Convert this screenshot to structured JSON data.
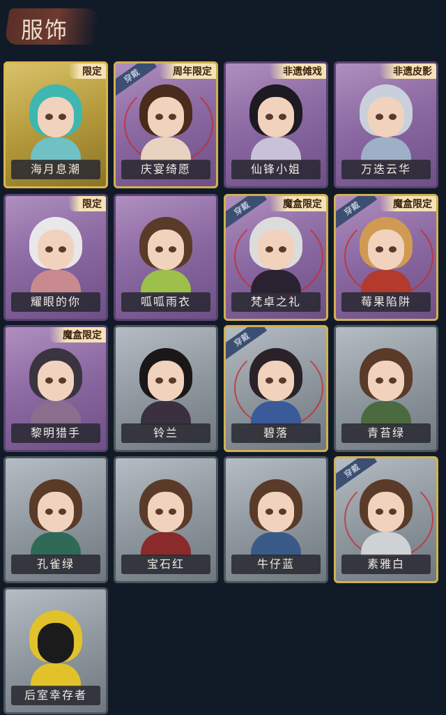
{
  "title": "服饰",
  "cards": [
    {
      "name": "海月息潮",
      "tag": "限定",
      "wearing": "",
      "frame": "gold",
      "hair": "#3fb7b0",
      "body": "#6fc1c4",
      "ring": false
    },
    {
      "name": "庆宴绮愿",
      "tag": "周年限定",
      "wearing": "穿戴",
      "frame": "purple-gold",
      "hair": "#4a2b1c",
      "body": "#e7d3c0",
      "ring": true
    },
    {
      "name": "仙锋小姐",
      "tag": "非遗傩戏",
      "wearing": "",
      "frame": "purple",
      "hair": "#1e1a22",
      "body": "#c8c2d8",
      "ring": false
    },
    {
      "name": "万迭云华",
      "tag": "非遗皮影",
      "wearing": "",
      "frame": "purple",
      "hair": "#c9d0dc",
      "body": "#9eb0c8",
      "ring": false
    },
    {
      "name": "耀眼的你",
      "tag": "限定",
      "wearing": "",
      "frame": "purple",
      "hair": "#e8e8ea",
      "body": "#c98a8f",
      "ring": false
    },
    {
      "name": "呱呱雨衣",
      "tag": "",
      "wearing": "",
      "frame": "purple",
      "hair": "#5a3a28",
      "body": "#9cc04a",
      "ring": false
    },
    {
      "name": "梵卓之礼",
      "tag": "魔盒限定",
      "wearing": "穿戴",
      "frame": "purple-gold",
      "hair": "#dcdcdc",
      "body": "#2a2230",
      "ring": true
    },
    {
      "name": "莓果陷阱",
      "tag": "魔盒限定",
      "wearing": "穿戴",
      "frame": "purple-gold",
      "hair": "#d09a52",
      "body": "#b33a2c",
      "ring": true
    },
    {
      "name": "黎明猎手",
      "tag": "魔盒限定",
      "wearing": "",
      "frame": "purple",
      "hair": "#3a3440",
      "body": "#8a6e8e",
      "ring": false
    },
    {
      "name": "铃兰",
      "tag": "",
      "wearing": "",
      "frame": "grey",
      "hair": "#1a1718",
      "body": "#3a3040",
      "ring": false
    },
    {
      "name": "碧落",
      "tag": "",
      "wearing": "穿戴",
      "frame": "grey-gold",
      "hair": "#2a2228",
      "body": "#3a5a9a",
      "ring": true
    },
    {
      "name": "青苔绿",
      "tag": "",
      "wearing": "",
      "frame": "grey",
      "hair": "#5a3a28",
      "body": "#4c6a40",
      "ring": false
    },
    {
      "name": "孔雀绿",
      "tag": "",
      "wearing": "",
      "frame": "grey",
      "hair": "#5a3a28",
      "body": "#2f6a58",
      "ring": false
    },
    {
      "name": "宝石红",
      "tag": "",
      "wearing": "",
      "frame": "grey",
      "hair": "#5a3a28",
      "body": "#8a2a2a",
      "ring": false
    },
    {
      "name": "牛仔蓝",
      "tag": "",
      "wearing": "",
      "frame": "grey",
      "hair": "#5a3a28",
      "body": "#3a5a8a",
      "ring": false
    },
    {
      "name": "素雅白",
      "tag": "",
      "wearing": "穿戴",
      "frame": "grey-gold",
      "hair": "#5a3a28",
      "body": "#cfd2d4",
      "ring": true
    },
    {
      "name": "后室幸存者",
      "tag": "",
      "wearing": "",
      "frame": "grey",
      "hair": "#e2c22a",
      "body": "#e2c22a",
      "ring": false,
      "mask": true
    }
  ]
}
